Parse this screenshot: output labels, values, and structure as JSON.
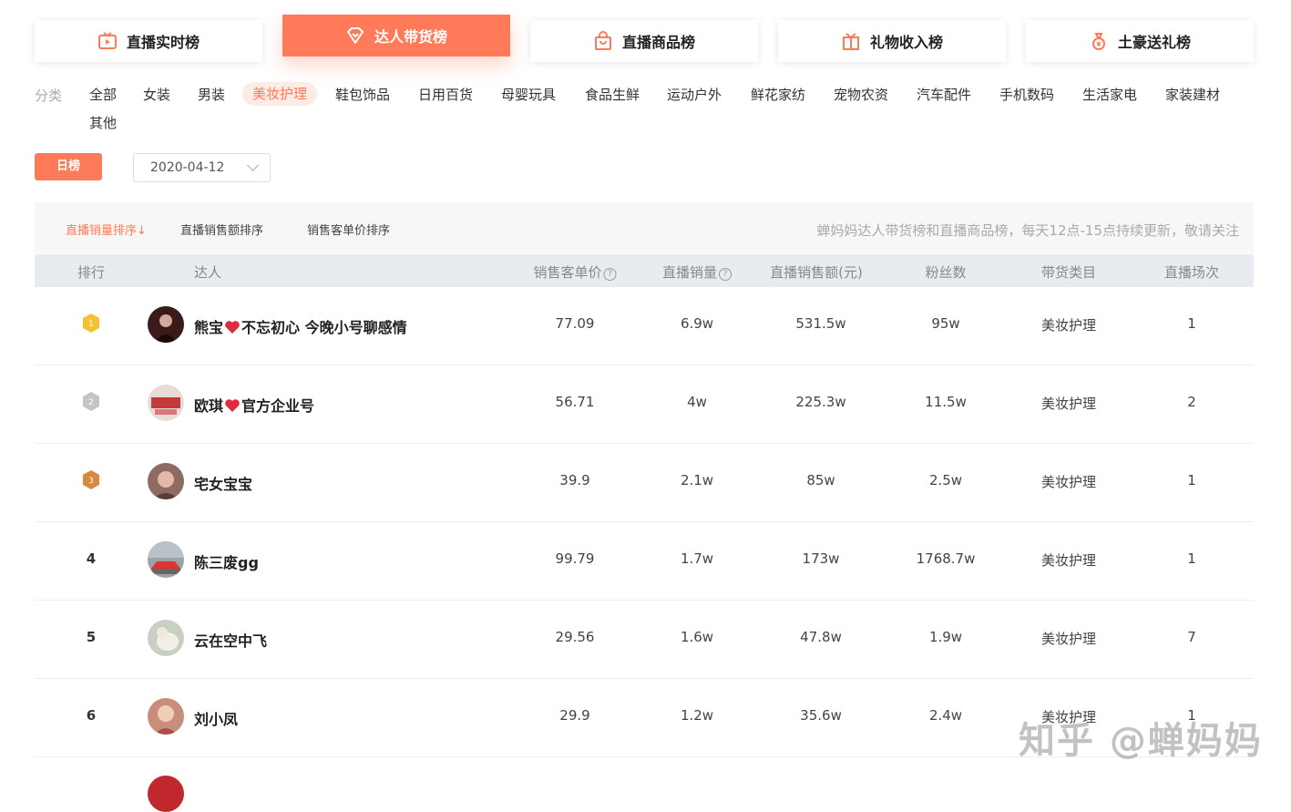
{
  "top_tabs": [
    {
      "label": "直播实时榜",
      "icon": "tv-play-icon"
    },
    {
      "label": "达人带货榜",
      "icon": "heart-diamond-icon",
      "active": true
    },
    {
      "label": "直播商品榜",
      "icon": "shopping-bag-icon"
    },
    {
      "label": "礼物收入榜",
      "icon": "gift-box-icon"
    },
    {
      "label": "土豪送礼榜",
      "icon": "money-bag-icon"
    }
  ],
  "categories": {
    "label": "分类",
    "items": [
      "全部",
      "女装",
      "男装",
      "美妆护理",
      "鞋包饰品",
      "日用百货",
      "母婴玩具",
      "食品生鲜",
      "运动户外",
      "鲜花家纺",
      "宠物农资",
      "汽车配件",
      "手机数码",
      "生活家电",
      "家装建材",
      "其他"
    ],
    "active": "美妆护理"
  },
  "controls": {
    "day_button": "日榜",
    "date_value": "2020-04-12"
  },
  "sort_bar": {
    "options": [
      "直播销量排序",
      "直播销售额排序",
      "销售客单价排序"
    ],
    "active_arrow": "↓",
    "notice": "蝉妈妈达人带货榜和直播商品榜，每天12点-15点持续更新，敬请关注"
  },
  "table": {
    "headers": {
      "rank": "排行",
      "talent": "达人",
      "unit_price": "销售客单价",
      "live_sales": "直播销量",
      "live_revenue": "直播销售额(元)",
      "fans": "粉丝数",
      "category": "带货类目",
      "sessions": "直播场次"
    },
    "help_glyph": "?",
    "rows": [
      {
        "rank": "1",
        "name": "熊宝",
        "heart": true,
        "name_suffix": "不忘初心 今晚小号聊感情",
        "unit_price": "77.09",
        "live_sales": "6.9w",
        "live_revenue": "531.5w",
        "fans": "95w",
        "category": "美妆护理",
        "sessions": "1",
        "avatar_color": "#3a1a1a"
      },
      {
        "rank": "2",
        "name": "欧琪",
        "heart": true,
        "name_suffix": "官方企业号",
        "unit_price": "56.71",
        "live_sales": "4w",
        "live_revenue": "225.3w",
        "fans": "11.5w",
        "category": "美妆护理",
        "sessions": "2",
        "avatar_color": "#e9dcd6"
      },
      {
        "rank": "3",
        "name": "宅女宝宝",
        "heart": false,
        "name_suffix": "",
        "unit_price": "39.9",
        "live_sales": "2.1w",
        "live_revenue": "85w",
        "fans": "2.5w",
        "category": "美妆护理",
        "sessions": "1",
        "avatar_color": "#8d6b63"
      },
      {
        "rank": "4",
        "name": "陈三废gg",
        "heart": false,
        "name_suffix": "",
        "unit_price": "99.79",
        "live_sales": "1.7w",
        "live_revenue": "173w",
        "fans": "1768.7w",
        "category": "美妆护理",
        "sessions": "1",
        "avatar_color": "#9aa3a8"
      },
      {
        "rank": "5",
        "name": "云在空中飞",
        "heart": false,
        "name_suffix": "",
        "unit_price": "29.56",
        "live_sales": "1.6w",
        "live_revenue": "47.8w",
        "fans": "1.9w",
        "category": "美妆护理",
        "sessions": "7",
        "avatar_color": "#c9cfc3"
      },
      {
        "rank": "6",
        "name": "刘小凤",
        "heart": false,
        "name_suffix": "",
        "unit_price": "29.9",
        "live_sales": "1.2w",
        "live_revenue": "35.6w",
        "fans": "2.4w",
        "category": "美妆护理",
        "sessions": "1",
        "avatar_color": "#c98d7c"
      }
    ]
  },
  "watermark": "知乎 @蝉妈妈",
  "colors": {
    "accent": "#ff7a59",
    "gold": "#f2c230",
    "silver": "#c4c4c4",
    "bronze": "#d88a3c"
  }
}
